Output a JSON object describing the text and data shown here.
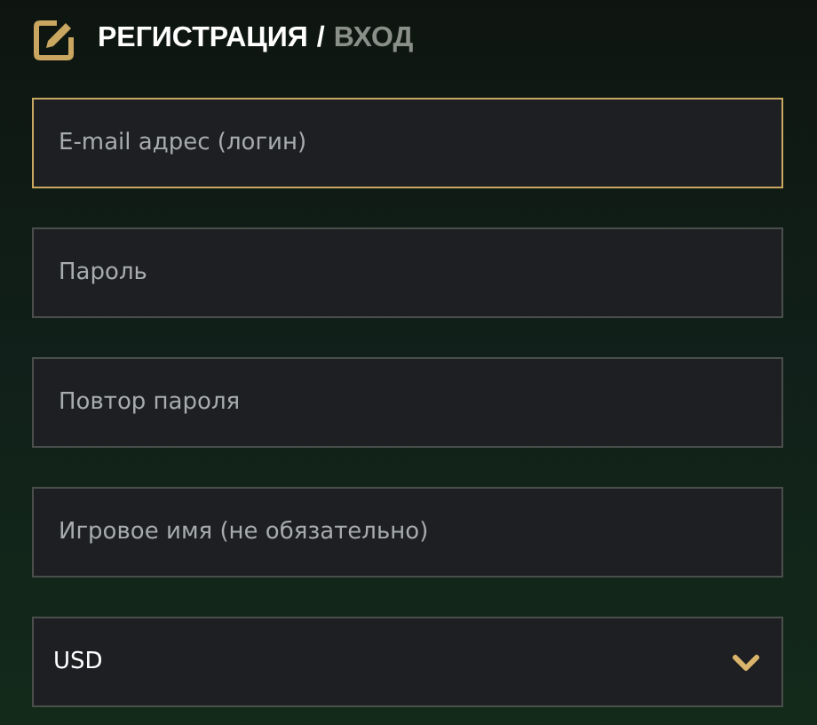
{
  "header": {
    "tabs": [
      {
        "label": "РЕГИСТРАЦИЯ",
        "selected": true
      },
      {
        "label": "ВХОД",
        "selected": false
      }
    ],
    "separator": "/"
  },
  "fields": [
    {
      "placeholder": "E-mail адрес (логин)",
      "focused": true
    },
    {
      "placeholder": "Пароль",
      "focused": false
    },
    {
      "placeholder": "Повтор пароля",
      "focused": false
    },
    {
      "placeholder": "Игровое имя (не обязательно)",
      "focused": false
    }
  ],
  "currency_select": {
    "value": "USD"
  }
}
